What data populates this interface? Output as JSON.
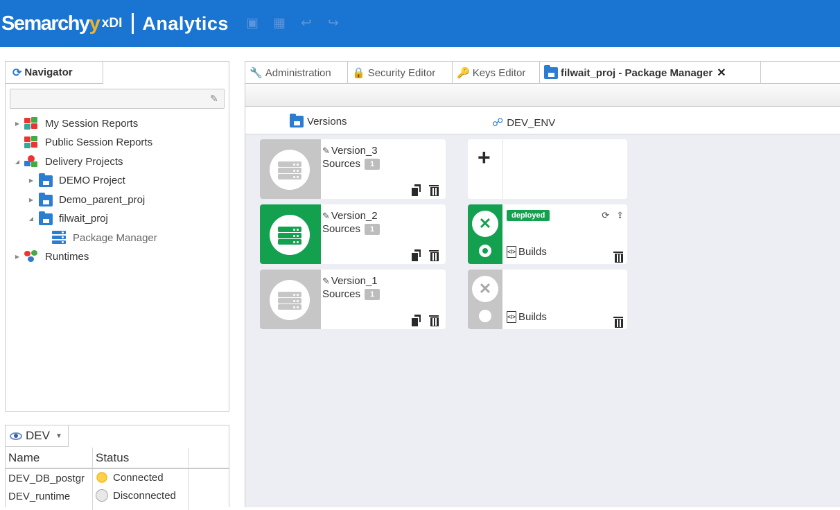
{
  "app": {
    "brand": "Semarchy",
    "brand_y": "y",
    "product": "xDI",
    "title": "Analytics",
    "header_icons": [
      "save-icon",
      "save-all-icon",
      "undo-icon",
      "redo-icon"
    ],
    "accent_color": "#1a74d2"
  },
  "navigator": {
    "tab_label": "Navigator",
    "search_value": "",
    "tree": [
      {
        "label": "My Session Reports",
        "icon": "session-report-icon",
        "expandable": true
      },
      {
        "label": "Public Session Reports",
        "icon": "session-report-icon",
        "expandable": false
      },
      {
        "label": "Delivery Projects",
        "icon": "delivery-projects-icon",
        "expandable": true,
        "expanded": true
      },
      {
        "label": "DEMO Project",
        "icon": "folder-icon",
        "expandable": true
      },
      {
        "label": "Demo_parent_proj",
        "icon": "folder-icon",
        "expandable": true
      },
      {
        "label": "filwait_proj",
        "icon": "folder-icon",
        "expandable": true,
        "expanded": true
      },
      {
        "label": "Package Manager",
        "icon": "package-manager-icon",
        "expandable": false
      },
      {
        "label": "Runtimes",
        "icon": "runtimes-icon",
        "expandable": true
      }
    ]
  },
  "environment": {
    "selected": "DEV",
    "columns": [
      "Name",
      "Status"
    ],
    "rows": [
      {
        "name": "DEV_DB_postgr",
        "status": "Connected",
        "status_icon": "sun-icon"
      },
      {
        "name": "DEV_runtime",
        "status": "Disconnected",
        "status_icon": "moon-icon"
      }
    ]
  },
  "editor_tabs": [
    {
      "label": "Administration",
      "icon": "wrench-icon"
    },
    {
      "label": "Security Editor",
      "icon": "lock-icon"
    },
    {
      "label": "Keys Editor",
      "icon": "key-icon"
    },
    {
      "label": "filwait_proj - Package Manager",
      "icon": "folder-icon",
      "active": true
    }
  ],
  "package_manager": {
    "versions_header": "Versions",
    "env_header": "DEV_ENV",
    "versions": [
      {
        "name": "Version_3",
        "sources_label": "Sources",
        "sources_count": "1",
        "active": false
      },
      {
        "name": "Version_2",
        "sources_label": "Sources",
        "sources_count": "1",
        "active": true
      },
      {
        "name": "Version_1",
        "sources_label": "Sources",
        "sources_count": "1",
        "active": false
      }
    ],
    "env_cards": [
      {
        "type": "add",
        "plus": "+"
      },
      {
        "type": "build",
        "status_badge": "deployed",
        "builds_label": "Builds",
        "deployed": true
      },
      {
        "type": "build",
        "builds_label": "Builds",
        "deployed": false
      }
    ]
  }
}
